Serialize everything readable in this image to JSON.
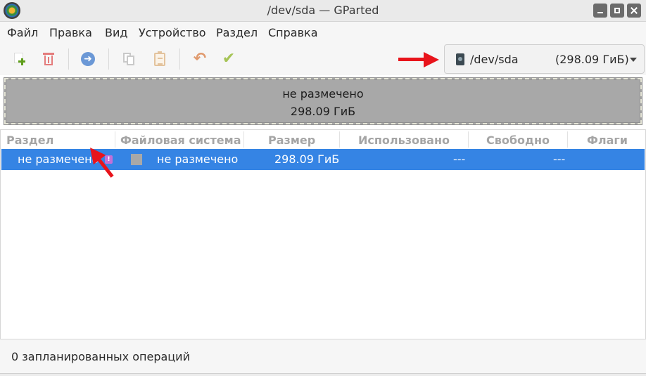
{
  "window": {
    "title": "/dev/sda — GParted"
  },
  "menu": {
    "items": [
      "Файл",
      "Правка",
      "Вид",
      "Устройство",
      "Раздел",
      "Справка"
    ]
  },
  "toolbar": {
    "icons": [
      "new-partition-icon",
      "delete-icon",
      "resize-move-icon",
      "copy-icon",
      "paste-icon",
      "undo-icon",
      "apply-icon"
    ]
  },
  "device": {
    "name": "/dev/sda",
    "size": "(298.09 ГиБ)"
  },
  "disk_graphic": {
    "label": "не размечено",
    "size": "298.09 ГиБ"
  },
  "table": {
    "headers": [
      "Раздел",
      "Файловая система",
      "Размер",
      "Использовано",
      "Свободно",
      "Флаги"
    ],
    "rows": [
      {
        "partition": "не размечено",
        "filesystem": "не размечено",
        "size": "298.09 ГиБ",
        "used": "---",
        "unused": "---",
        "flags": ""
      }
    ],
    "selected_color": "#3584e4",
    "warning_icon": "warning-icon"
  },
  "status": {
    "text": "0 запланированных операций"
  },
  "annotations": {
    "color": "#e8141b"
  }
}
